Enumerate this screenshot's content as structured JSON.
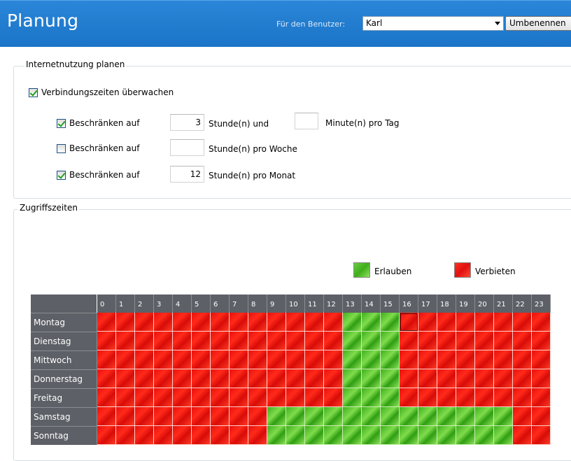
{
  "header": {
    "title": "Planung",
    "user_label": "Für den Benutzer:",
    "user_value": "Karl",
    "rename_button": "Umbenennen"
  },
  "internet": {
    "legend": "Internetnutzung planen",
    "monitor_label": "Verbindungszeiten überwachen",
    "monitor_checked": true,
    "limits": [
      {
        "checked": true,
        "label": "Beschränken auf",
        "value": "3",
        "unit": "Stunde(n) und",
        "extra_value": "",
        "extra_unit": "Minute(n) pro Tag"
      },
      {
        "checked": false,
        "label": "Beschränken auf",
        "value": "",
        "unit": "Stunde(n) pro Woche"
      },
      {
        "checked": true,
        "label": "Beschränken auf",
        "value": "12",
        "unit": "Stunde(n) pro Monat"
      }
    ]
  },
  "access": {
    "legend": "Zugriffszeiten",
    "allow_label": "Erlauben",
    "deny_label": "Verbieten",
    "allow_color": "#4cbf24",
    "deny_color": "#f01a10",
    "hours": [
      "0",
      "1",
      "2",
      "3",
      "4",
      "5",
      "6",
      "7",
      "8",
      "9",
      "10",
      "11",
      "12",
      "13",
      "14",
      "15",
      "16",
      "17",
      "18",
      "19",
      "20",
      "21",
      "22",
      "23"
    ],
    "days": [
      {
        "name": "Montag",
        "allowed": [
          13,
          14,
          15
        ]
      },
      {
        "name": "Dienstag",
        "allowed": [
          13,
          14,
          15
        ]
      },
      {
        "name": "Mittwoch",
        "allowed": [
          13,
          14,
          15
        ]
      },
      {
        "name": "Donnerstag",
        "allowed": [
          13,
          14,
          15
        ]
      },
      {
        "name": "Freitag",
        "allowed": [
          13,
          14,
          15
        ]
      },
      {
        "name": "Samstag",
        "allowed": [
          9,
          10,
          11,
          12,
          13,
          14,
          15,
          16,
          17,
          18,
          19,
          20,
          21
        ]
      },
      {
        "name": "Sonntag",
        "allowed": [
          9,
          10,
          11,
          12,
          13,
          14,
          15,
          16,
          17,
          18,
          19,
          20,
          21
        ]
      }
    ],
    "selected_cell": {
      "day": "Montag",
      "hour": 16
    }
  }
}
